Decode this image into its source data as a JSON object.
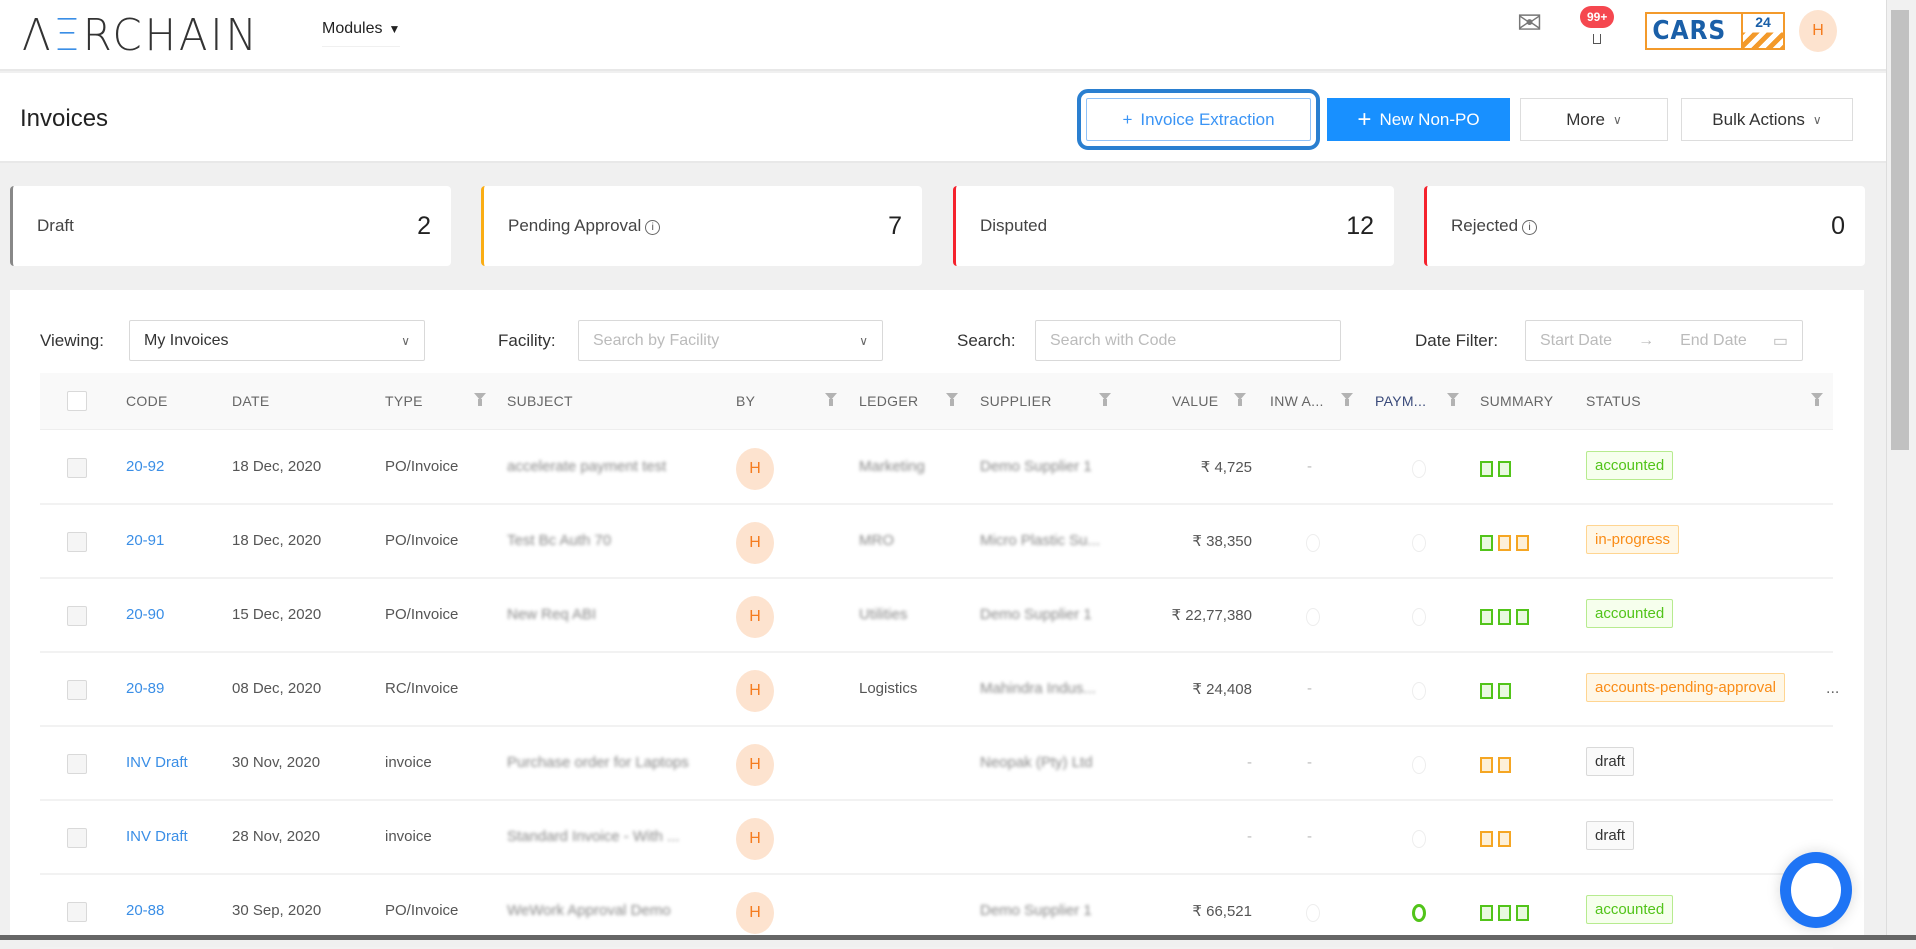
{
  "header": {
    "logo_left": "Λ",
    "logo_e": "Ξ",
    "logo_rest": "RCHAIN",
    "modules": "Modules",
    "notif_badge": "99+",
    "brand": "CARS",
    "brand_num": "24",
    "user_initial": "H"
  },
  "page": {
    "title": "Invoices",
    "btn_extraction": "Invoice Extraction",
    "btn_new": "New Non-PO",
    "btn_more": "More",
    "btn_bulk": "Bulk Actions"
  },
  "cards": [
    {
      "label": "Draft",
      "value": "2",
      "color": "#888888"
    },
    {
      "label": "Pending Approval",
      "value": "7",
      "color": "#faad14",
      "info": true
    },
    {
      "label": "Disputed",
      "value": "12",
      "color": "#f5222d"
    },
    {
      "label": "Rejected",
      "value": "0",
      "color": "#f5222d",
      "info": true
    }
  ],
  "filters": {
    "viewing_label": "Viewing:",
    "viewing_value": "My Invoices",
    "facility_label": "Facility:",
    "facility_placeholder": "Search by Facility",
    "search_label": "Search:",
    "search_placeholder": "Search with Code",
    "date_label": "Date Filter:",
    "start_placeholder": "Start Date",
    "end_placeholder": "End Date"
  },
  "columns": [
    "CODE",
    "DATE",
    "TYPE",
    "SUBJECT",
    "BY",
    "LEDGER",
    "SUPPLIER",
    "VALUE",
    "INW A...",
    "PAYM...",
    "SUMMARY",
    "STATUS"
  ],
  "rows": [
    {
      "code": "20-92",
      "date": "18 Dec, 2020",
      "type": "PO/Invoice",
      "subject": "accelerate payment test",
      "by": "H",
      "ledger": "Marketing",
      "supplier": "Demo Supplier 1",
      "value": "₹ 4,725",
      "inw": "-",
      "paym": "",
      "summary": [
        "g",
        "g"
      ],
      "status": "accounted",
      "st": "accounted"
    },
    {
      "code": "20-91",
      "date": "18 Dec, 2020",
      "type": "PO/Invoice",
      "subject": "Test Bc Auth 70",
      "by": "H",
      "ledger": "MRO",
      "supplier": "Micro Plastic Su...",
      "value": "₹ 38,350",
      "inw": "",
      "paym": "",
      "summary": [
        "g",
        "o",
        "o"
      ],
      "status": "in-progress",
      "st": "progress"
    },
    {
      "code": "20-90",
      "date": "15 Dec, 2020",
      "type": "PO/Invoice",
      "subject": "New Req ABI",
      "by": "H",
      "ledger": "Utilities",
      "supplier": "Demo Supplier 1",
      "value": "₹ 22,77,380",
      "inw": "",
      "paym": "",
      "summary": [
        "g",
        "g",
        "g"
      ],
      "status": "accounted",
      "st": "accounted"
    },
    {
      "code": "20-89",
      "date": "08 Dec, 2020",
      "type": "RC/Invoice",
      "subject": "",
      "by": "H",
      "ledger": "Logistics",
      "supplier": "Mahindra Indus...",
      "value": "₹ 24,408",
      "inw": "-",
      "paym": "",
      "summary": [
        "g",
        "g"
      ],
      "status": "accounts-pending-approval",
      "st": "progress",
      "more": "..."
    },
    {
      "code": "INV Draft",
      "date": "30 Nov, 2020",
      "type": "invoice",
      "subject": "Purchase order for Laptops",
      "by": "H",
      "ledger": "",
      "supplier": "Neopak (Pty) Ltd",
      "value": "-",
      "inw": "-",
      "paym": "",
      "summary": [
        "o",
        "o"
      ],
      "status": "draft",
      "st": "draft"
    },
    {
      "code": "INV Draft",
      "date": "28 Nov, 2020",
      "type": "invoice",
      "subject": "Standard Invoice - With ...",
      "by": "H",
      "ledger": "",
      "supplier": "",
      "value": "-",
      "inw": "-",
      "paym": "",
      "summary": [
        "o",
        "o"
      ],
      "status": "draft",
      "st": "draft"
    },
    {
      "code": "20-88",
      "date": "30 Sep, 2020",
      "type": "PO/Invoice",
      "subject": "WeWork Approval Demo",
      "by": "H",
      "ledger": "",
      "supplier": "Demo Supplier 1",
      "value": "₹ 66,521",
      "inw": "",
      "paym": "on",
      "summary": [
        "g",
        "g",
        "g"
      ],
      "status": "accounted",
      "st": "accounted"
    }
  ]
}
